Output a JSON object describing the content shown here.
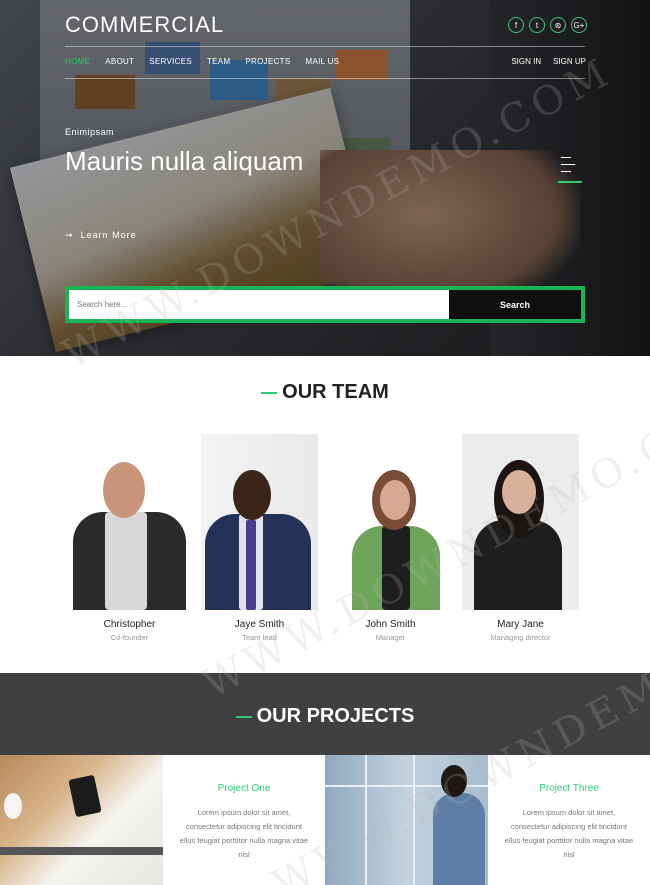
{
  "brand": "COMMERCIAL",
  "social": [
    {
      "icon": "facebook-icon",
      "glyph": "f"
    },
    {
      "icon": "twitter-icon",
      "glyph": "t"
    },
    {
      "icon": "dribbble-icon",
      "glyph": "⊛"
    },
    {
      "icon": "google-plus-icon",
      "glyph": "G+"
    }
  ],
  "nav": [
    "HOME",
    "ABOUT",
    "SERVICES",
    "TEAM",
    "PROJECTS",
    "MAIL US"
  ],
  "auth": {
    "signin": "SIGN IN",
    "signup": "SIGN UP"
  },
  "hero": {
    "kicker": "Enimipsam",
    "headline": "Mauris nulla aliquam",
    "learn_more": "Learn More",
    "learn_more_glyph": "➞"
  },
  "search": {
    "placeholder": "Search here...",
    "button": "Search"
  },
  "team": {
    "title": "OUR TEAM",
    "members": [
      {
        "name": "Christopher",
        "role": "Co-founder"
      },
      {
        "name": "Jaye Smith",
        "role": "Team lead"
      },
      {
        "name": "John Smith",
        "role": "Manager"
      },
      {
        "name": "Mary Jane",
        "role": "Managing director"
      }
    ]
  },
  "projects": {
    "title": "OUR PROJECTS",
    "items": [
      {
        "title": "Project One",
        "body": "Lorem ipsum dolor sit amet, consectetur adipiscing elit tincidunt ellus feugiat porttitor nulla magna vitae nisl"
      },
      {
        "title": "Project Three",
        "body": "Lorem ipsum dolor sit amet, consectetur adipiscing elit tincidunt ellus feugiat porttitor nulla magna vitae nisl"
      }
    ]
  },
  "watermark": "WWW.DOWNDEMO.COM",
  "colors": {
    "accent": "#2ecc71",
    "dark": "#404042"
  }
}
